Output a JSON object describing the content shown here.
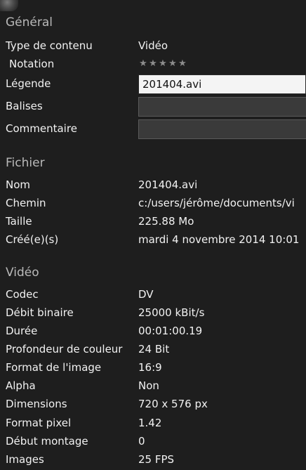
{
  "general": {
    "title": "Général",
    "content_type": {
      "label": "Type de contenu",
      "value": "Vidéo"
    },
    "rating": {
      "label": "Notation",
      "stars": 5,
      "filled": 0
    },
    "caption": {
      "label": "Légende",
      "value": "201404.avi"
    },
    "tags": {
      "label": "Balises",
      "value": ""
    },
    "comment": {
      "label": "Commentaire",
      "value": ""
    }
  },
  "file": {
    "title": "Fichier",
    "name": {
      "label": "Nom",
      "value": "201404.avi"
    },
    "path": {
      "label": "Chemin",
      "value": "c:/users/jérôme/documents/vi"
    },
    "size": {
      "label": "Taille",
      "value": "225.88 Mo"
    },
    "created": {
      "label": "Créé(e)(s)",
      "value": "mardi 4 novembre 2014 10:01"
    }
  },
  "video": {
    "title": "Vidéo",
    "codec": {
      "label": "Codec",
      "value": "DV"
    },
    "bitrate": {
      "label": "Débit binaire",
      "value": "25000 kBit/s"
    },
    "duration": {
      "label": "Durée",
      "value": "00:01:00.19"
    },
    "color_depth": {
      "label": "Profondeur de couleur",
      "value": "24 Bit"
    },
    "aspect": {
      "label": "Format de l'image",
      "value": "16:9"
    },
    "alpha": {
      "label": "Alpha",
      "value": "Non"
    },
    "dimensions": {
      "label": "Dimensions",
      "value": "720 x 576 px"
    },
    "pixel_format": {
      "label": "Format pixel",
      "value": "1.42"
    },
    "edit_start": {
      "label": "Début montage",
      "value": "0"
    },
    "frames": {
      "label": "Images",
      "value": "25 FPS"
    }
  },
  "colors": {
    "background": "#1e1e1e",
    "section_title": "#b9b9b9",
    "text": "#f2f2f2",
    "star": "#8c8c8c"
  }
}
